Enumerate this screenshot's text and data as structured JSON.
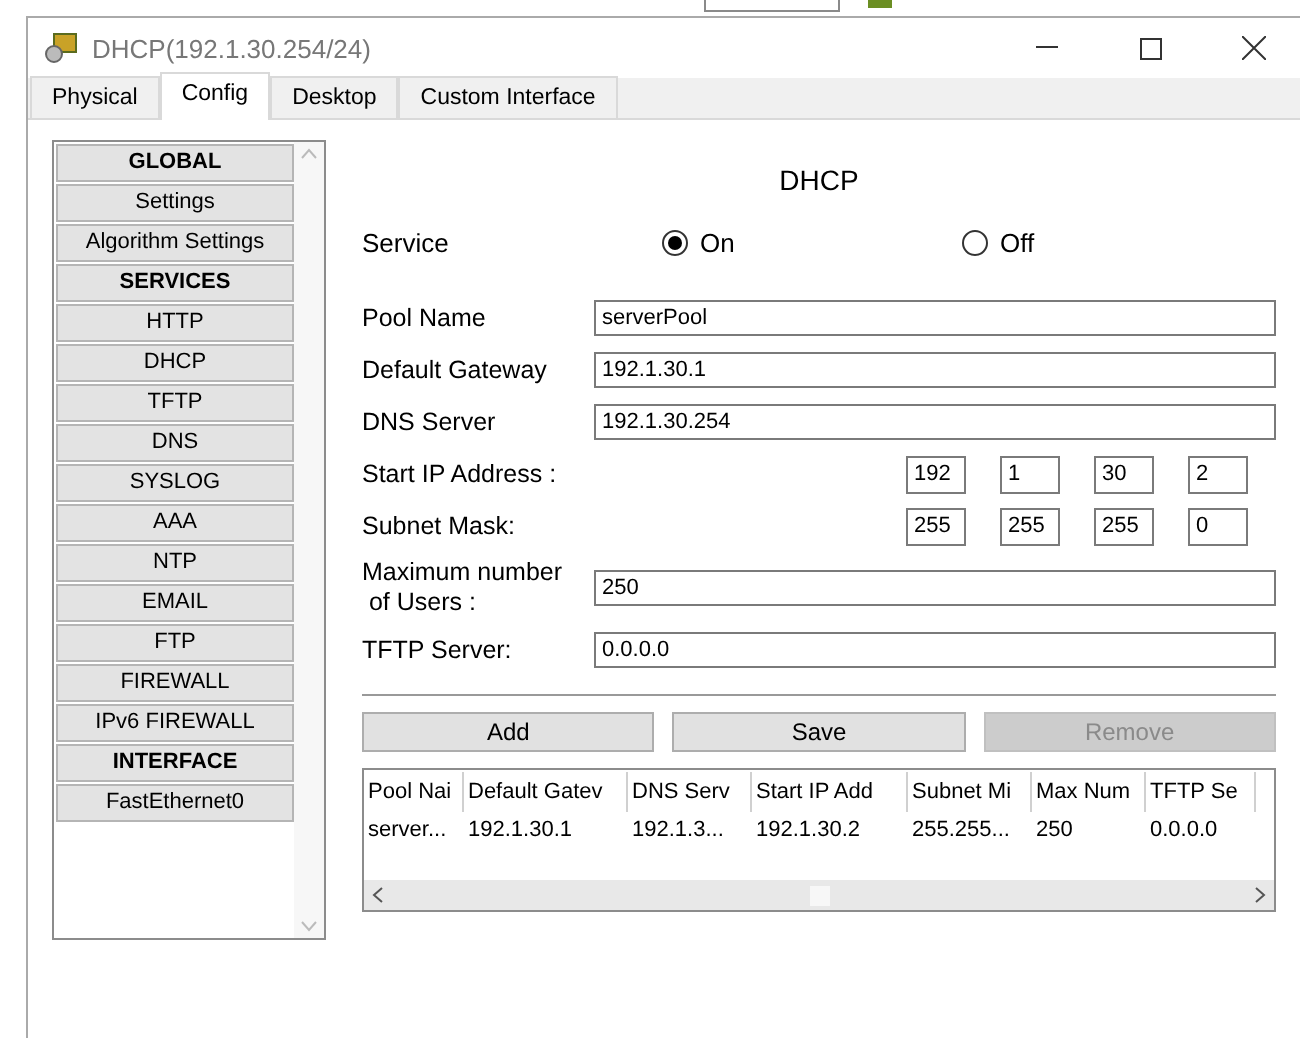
{
  "window": {
    "title": "DHCP(192.1.30.254/24)"
  },
  "tabs": [
    {
      "label": "Physical",
      "selected": false
    },
    {
      "label": "Config",
      "selected": true
    },
    {
      "label": "Desktop",
      "selected": false
    },
    {
      "label": "Custom Interface",
      "selected": false
    }
  ],
  "sidebar": {
    "items": [
      {
        "label": "GLOBAL",
        "kind": "header"
      },
      {
        "label": "Settings",
        "kind": "item"
      },
      {
        "label": "Algorithm Settings",
        "kind": "item"
      },
      {
        "label": "SERVICES",
        "kind": "header"
      },
      {
        "label": "HTTP",
        "kind": "item"
      },
      {
        "label": "DHCP",
        "kind": "item"
      },
      {
        "label": "TFTP",
        "kind": "item"
      },
      {
        "label": "DNS",
        "kind": "item"
      },
      {
        "label": "SYSLOG",
        "kind": "item"
      },
      {
        "label": "AAA",
        "kind": "item"
      },
      {
        "label": "NTP",
        "kind": "item"
      },
      {
        "label": "EMAIL",
        "kind": "item"
      },
      {
        "label": "FTP",
        "kind": "item"
      },
      {
        "label": "FIREWALL",
        "kind": "item"
      },
      {
        "label": "IPv6 FIREWALL",
        "kind": "item"
      },
      {
        "label": "INTERFACE",
        "kind": "header"
      },
      {
        "label": "FastEthernet0",
        "kind": "item"
      }
    ]
  },
  "panel": {
    "title": "DHCP",
    "service": {
      "label": "Service",
      "options": [
        {
          "label": "On",
          "selected": true
        },
        {
          "label": "Off",
          "selected": false
        }
      ]
    },
    "fields": [
      {
        "label": "Pool Name",
        "kind": "text",
        "value": "serverPool"
      },
      {
        "label": "Default Gateway",
        "kind": "text",
        "value": "192.1.30.1"
      },
      {
        "label": "DNS Server",
        "kind": "text",
        "value": "192.1.30.254"
      },
      {
        "label": "Start IP Address :",
        "kind": "octets",
        "octets": [
          "192",
          "1",
          "30",
          "2"
        ]
      },
      {
        "label": "Subnet Mask:",
        "kind": "octets",
        "octets": [
          "255",
          "255",
          "255",
          "0"
        ]
      },
      {
        "label": "Maximum number\n of Users :",
        "kind": "text",
        "value": "250"
      },
      {
        "label": "TFTP Server:",
        "kind": "text",
        "value": "0.0.0.0"
      }
    ],
    "buttons": [
      {
        "label": "Add",
        "disabled": false
      },
      {
        "label": "Save",
        "disabled": false
      },
      {
        "label": "Remove",
        "disabled": true
      }
    ],
    "table": {
      "columns": [
        "Pool Nai",
        "Default Gatev",
        "DNS Serv",
        "Start IP Add",
        "Subnet Mi",
        "Max Num",
        "TFTP Se"
      ],
      "rows": [
        [
          "server...",
          "192.1.30.1",
          "192.1.3...",
          "192.1.30.2",
          "255.255...",
          "250",
          "0.0.0.0"
        ]
      ]
    }
  }
}
